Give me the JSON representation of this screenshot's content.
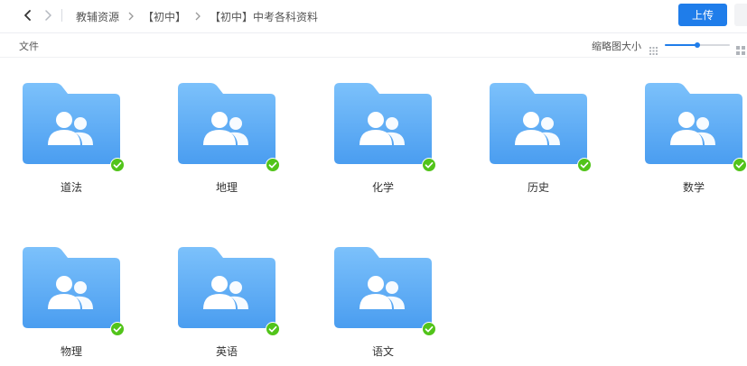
{
  "header": {
    "breadcrumb": [
      "教辅资源",
      "【初中】",
      "【初中】中考各科资料"
    ],
    "upload_label": "上传"
  },
  "toolbar": {
    "column_file_label": "文件",
    "thumbnail_size_label": "缩略图大小",
    "thumbnail_size_level": 0.5
  },
  "colors": {
    "accent": "#1f7dea",
    "folder_light": "#7cc1fb",
    "folder_dark": "#4a9df0",
    "sync_ok": "#52c41a"
  },
  "folders": [
    {
      "name": "道法",
      "icon": "shared-folder-icon",
      "synced": true
    },
    {
      "name": "地理",
      "icon": "shared-folder-icon",
      "synced": true
    },
    {
      "name": "化学",
      "icon": "shared-folder-icon",
      "synced": true
    },
    {
      "name": "历史",
      "icon": "shared-folder-icon",
      "synced": true
    },
    {
      "name": "数学",
      "icon": "shared-folder-icon",
      "synced": true
    },
    {
      "name": "物理",
      "icon": "shared-folder-icon",
      "synced": true
    },
    {
      "name": "英语",
      "icon": "shared-folder-icon",
      "synced": true
    },
    {
      "name": "语文",
      "icon": "shared-folder-icon",
      "synced": true
    }
  ]
}
